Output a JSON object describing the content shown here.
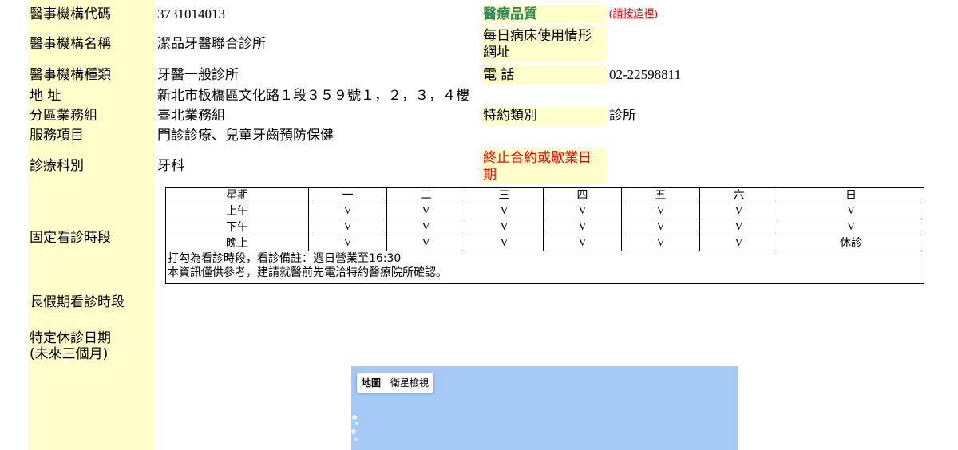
{
  "info": {
    "code_label": "醫事機構代碼",
    "code_value": "3731014013",
    "quality_label": "醫療品質",
    "quality_link": "(請按這裡)",
    "name_label": "醫事機構名稱",
    "name_value": "潔品牙醫聯合診所",
    "bed_label_line1": "每日病床使用情形",
    "bed_label_line2": "網址",
    "type_label": "醫事機構種類",
    "type_value": "牙醫一般診所",
    "phone_label": "電 話",
    "phone_value": "02-22598811",
    "address_label": "地 址",
    "address_value": "新北市板橋區文化路１段３５９號１，２，３，４樓",
    "branch_label": "分區業務組",
    "branch_value": "臺北業務組",
    "contract_label": "特約類別",
    "contract_value": "診所",
    "service_label": "服務項目",
    "service_value": "門診診療、兒童牙齒預防保健",
    "dept_label": "診療科別",
    "dept_value": "牙科",
    "terminate_label_line1": "終止合約或歇業日",
    "terminate_label_line2": "期",
    "schedule_label": "固定看診時段",
    "long_holiday_label": "長假期看診時段",
    "specific_off_label_line1": "特定休診日期",
    "specific_off_label_line2": "(未來三個月)"
  },
  "schedule": {
    "header": [
      "星期",
      "一",
      "二",
      "三",
      "四",
      "五",
      "六",
      "日"
    ],
    "rows": [
      [
        "上午",
        "V",
        "V",
        "V",
        "V",
        "V",
        "V",
        "V"
      ],
      [
        "下午",
        "V",
        "V",
        "V",
        "V",
        "V",
        "V",
        "V"
      ],
      [
        "晚上",
        "V",
        "V",
        "V",
        "V",
        "V",
        "V",
        "休診"
      ]
    ],
    "note_line1": "打勾為看診時段，看診備註：週日營業至16:30",
    "note_line2": "本資訊僅供參考，建請就醫前先電洽特約醫療院所確認。"
  },
  "map": {
    "tab_map": "地圖",
    "tab_satellite": "衛星檢視"
  },
  "colors": {
    "label_bg": "#ffffcc",
    "quality_green": "#2e8b57",
    "link_red": "#cc0000",
    "terminate_red": "#ff0000",
    "map_water": "#a4c9f6"
  }
}
